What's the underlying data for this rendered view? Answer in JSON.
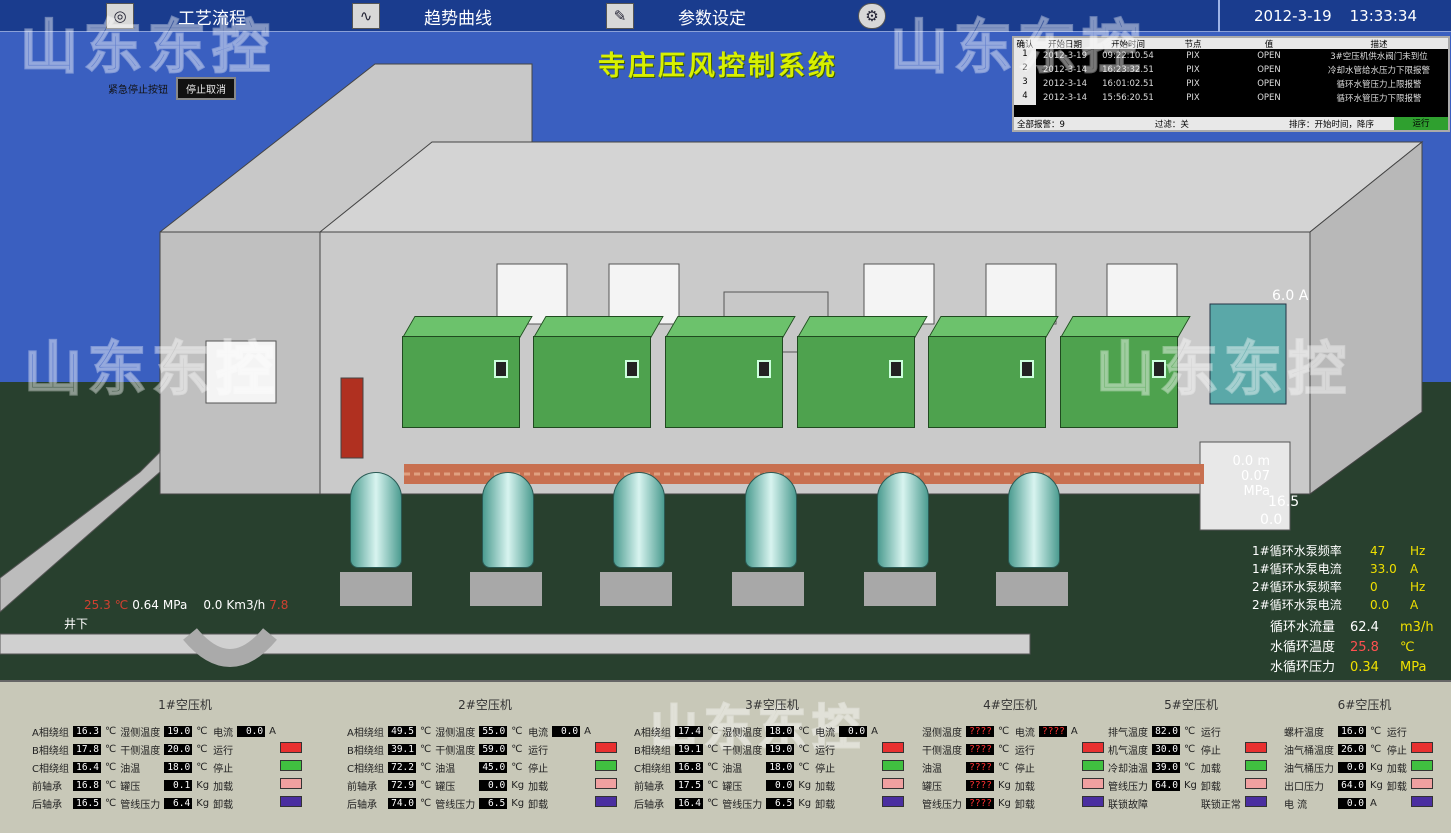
{
  "nav": [
    {
      "label": "工艺流程",
      "icon": "globe-icon"
    },
    {
      "label": "趋势曲线",
      "icon": "chart-icon"
    },
    {
      "label": "参数设定",
      "icon": "settings-icon"
    },
    {
      "label": "",
      "icon": "lock-icon"
    }
  ],
  "clock": {
    "date": "2012-3-19",
    "time": "13:33:34"
  },
  "title": "寺庄压风控制系统",
  "mode": {
    "label": "紧急停止按钮",
    "button": "停止取消"
  },
  "alarm": {
    "headers": [
      "确认",
      "开始日期",
      "开始时间",
      "节点",
      "值",
      "描述"
    ],
    "rows": [
      [
        "1",
        "2012-3-19",
        "09:22:10.54",
        "PIX",
        "OPEN",
        "3#空压机供水阀门未到位"
      ],
      [
        "2",
        "2012-3-14",
        "16:23:32.51",
        "PIX",
        "OPEN",
        "冷却水管给水压力下限报警"
      ],
      [
        "3",
        "2012-3-14",
        "16:01:02.51",
        "PIX",
        "OPEN",
        "循环水管压力上限报警"
      ],
      [
        "4",
        "2012-3-14",
        "15:56:20.51",
        "PIX",
        "OPEN",
        "循环水管压力下限报警"
      ]
    ],
    "footer": {
      "total": "全部报警：9",
      "filter": "过滤：关",
      "sort": "排序：开始时间，降序",
      "status": "运行"
    }
  },
  "watermark": "山东东控",
  "cooling_tower": {
    "current": "6.0 A"
  },
  "pump_box": {
    "level": "0.0 m",
    "pressure": "0.07 MPa",
    "freq": "16.5",
    "current": "0.0"
  },
  "pump_stats": [
    {
      "label": "1#循环水泵频率",
      "value": "47",
      "unit": "Hz"
    },
    {
      "label": "1#循环水泵电流",
      "value": "33.0",
      "unit": "A"
    },
    {
      "label": "2#循环水泵频率",
      "value": "0",
      "unit": "Hz"
    },
    {
      "label": "2#循环水泵电流",
      "value": "0.0",
      "unit": "A"
    }
  ],
  "water_stats": [
    {
      "label": "循环水流量",
      "value": "62.4",
      "unit": "m3/h"
    },
    {
      "label": "水循环温度",
      "value": "25.8",
      "unit": "℃"
    },
    {
      "label": "水循环压力",
      "value": "0.34",
      "unit": "MPa"
    }
  ],
  "main_pipe": {
    "temp": "25.3",
    "temp_unit": "℃",
    "pressure": "0.64",
    "pressure_unit": "MPa",
    "flow": "0.0",
    "flow_unit": "Km3/h",
    "other": "7.8",
    "label": "井下"
  },
  "groups": [
    {
      "title": "1#空压机",
      "rows": [
        [
          "A相绕组",
          "16.3",
          "℃",
          "湿侧温度",
          "19.0",
          "℃",
          "电流",
          "0.0",
          "A"
        ],
        [
          "B相绕组",
          "17.8",
          "℃",
          "干侧温度",
          "20.0",
          "℃",
          "运行",
          "",
          ""
        ],
        [
          "C相绕组",
          "16.4",
          "℃",
          "油温",
          "18.0",
          "℃",
          "停止",
          "",
          ""
        ],
        [
          "前轴承",
          "16.8",
          "℃",
          "罐压",
          "0.1",
          "Kg",
          "加载",
          "",
          ""
        ],
        [
          "后轴承",
          "16.5",
          "℃",
          "管线压力",
          "6.4",
          "Kg",
          "卸载",
          "",
          ""
        ]
      ]
    },
    {
      "title": "2#空压机",
      "rows": [
        [
          "A相绕组",
          "49.5",
          "℃",
          "湿侧温度",
          "55.0",
          "℃",
          "电流",
          "0.0",
          "A"
        ],
        [
          "B相绕组",
          "39.1",
          "℃",
          "干侧温度",
          "59.0",
          "℃",
          "运行",
          "",
          ""
        ],
        [
          "C相绕组",
          "72.2",
          "℃",
          "油温",
          "45.0",
          "℃",
          "停止",
          "",
          ""
        ],
        [
          "前轴承",
          "72.9",
          "℃",
          "罐压",
          "0.0",
          "Kg",
          "加载",
          "",
          ""
        ],
        [
          "后轴承",
          "74.0",
          "℃",
          "管线压力",
          "6.5",
          "Kg",
          "卸载",
          "",
          ""
        ]
      ]
    },
    {
      "title": "3#空压机",
      "rows": [
        [
          "A相绕组",
          "17.4",
          "℃",
          "湿侧温度",
          "18.0",
          "℃",
          "电流",
          "0.0",
          "A"
        ],
        [
          "B相绕组",
          "19.1",
          "℃",
          "干侧温度",
          "19.0",
          "℃",
          "运行",
          "",
          ""
        ],
        [
          "C相绕组",
          "16.8",
          "℃",
          "油温",
          "18.0",
          "℃",
          "停止",
          "",
          ""
        ],
        [
          "前轴承",
          "17.5",
          "℃",
          "罐压",
          "0.0",
          "Kg",
          "加载",
          "",
          ""
        ],
        [
          "后轴承",
          "16.4",
          "℃",
          "管线压力",
          "6.5",
          "Kg",
          "卸载",
          "",
          ""
        ]
      ]
    },
    {
      "title": "4#空压机",
      "rows": [
        [
          "湿侧温度",
          "????",
          "℃",
          "电流",
          "????",
          "A"
        ],
        [
          "干侧温度",
          "????",
          "℃",
          "运行",
          "",
          ""
        ],
        [
          "油温",
          "????",
          "℃",
          "停止",
          "",
          ""
        ],
        [
          "罐压",
          "????",
          "Kg",
          "加载",
          "",
          ""
        ],
        [
          "管线压力",
          "????",
          "Kg",
          "卸载",
          "",
          ""
        ]
      ]
    },
    {
      "title": "5#空压机",
      "rows": [
        [
          "排气温度",
          "82.0",
          "℃",
          "运行"
        ],
        [
          "机气温度",
          "30.0",
          "℃",
          "停止"
        ],
        [
          "冷却油温",
          "39.0",
          "℃",
          "加载"
        ],
        [
          "管线压力",
          "64.0",
          "Kg",
          "卸载"
        ],
        [
          "联锁故障",
          "",
          "",
          "联锁正常"
        ]
      ]
    },
    {
      "title": "6#空压机",
      "rows": [
        [
          "螺杆温度",
          "16.0",
          "℃",
          "运行"
        ],
        [
          "油气桶温度",
          "26.0",
          "℃",
          "停止"
        ],
        [
          "油气桶压力",
          "0.0",
          "Kg",
          "加载"
        ],
        [
          "出口压力",
          "64.0",
          "Kg",
          "卸载"
        ],
        [
          "电  流",
          "0.0",
          "A",
          ""
        ]
      ]
    }
  ],
  "colors": {
    "run": "#3fa03f",
    "stop": "#e83030",
    "load": "#f0a0a0",
    "unload": "#4a2ea0",
    "green_led": "#40c040"
  }
}
